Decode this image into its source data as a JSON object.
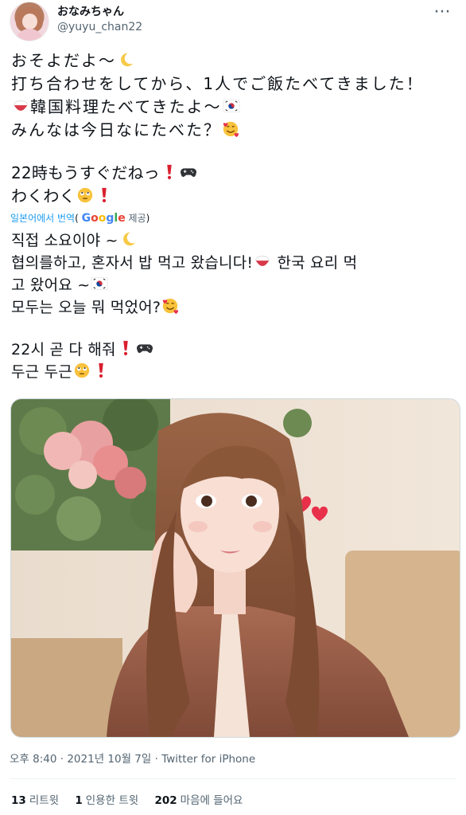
{
  "author": {
    "display_name": "おなみちゃん",
    "handle": "@yuyu_chan22",
    "more_icon": "more-horizontal-icon"
  },
  "tweet": {
    "original_lines": [
      "おそよだよ～",
      "打ち合わせをしてから、1人でご飯たべてきました！",
      "韓国料理たべてきたよ～",
      "みんなは今日なにたべた？",
      "22時もうすぐだねっ",
      "わくわく"
    ],
    "translate_label": "일본어에서 번역",
    "translate_brand": "Google",
    "translate_provider": "제공",
    "translated_lines": [
      "직접 소요이야 ~",
      " 협의를하고, 혼자서 밥 먹고 왔습니다!",
      " 한국 요리 먹",
      "고 왔어요 ~",
      " 모두는 오늘 뭐 먹었어?",
      "22시 곧 다 해줘",
      " 두근 두근"
    ],
    "emoji_names": [
      "crescent-moon-icon",
      "rice-bowl-icon",
      "korea-flag-icon",
      "smiling-hearts-icon",
      "exclamation-icon",
      "game-controller-icon",
      "rolling-eyes-icon"
    ]
  },
  "meta": {
    "time": "오후 8:40",
    "date": "2021년 10월 7일",
    "separator": "·",
    "source": "Twitter for iPhone"
  },
  "stats": {
    "retweets_count": "13",
    "retweets_label": "리트윗",
    "quotes_count": "1",
    "quotes_label": "인용한 트윗",
    "likes_count": "202",
    "likes_label": "마음에 들어요"
  },
  "colors": {
    "link": "#1d9bf0",
    "text": "#0f1419",
    "muted": "#536471",
    "border": "#cfd9de"
  }
}
